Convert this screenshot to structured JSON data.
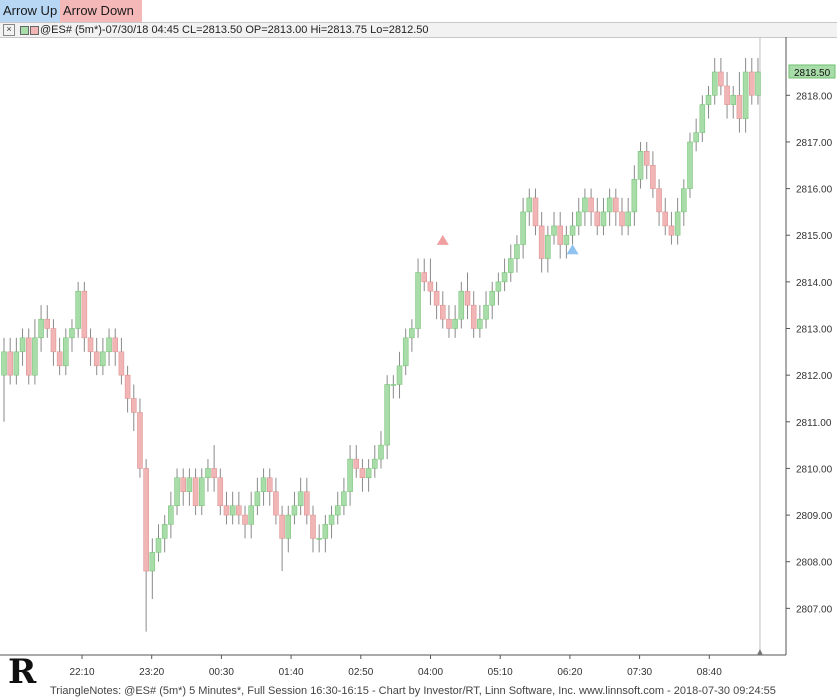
{
  "toolbar": {
    "arrow_up_label": "Arrow Up",
    "arrow_down_label": "Arrow Down",
    "arrow_up_color": "#b7d7f5",
    "arrow_down_color": "#f5b8b8"
  },
  "header": {
    "info": "@ES# (5m*)-07/30/18 04:45 CL=2813.50 OP=2813.00 Hi=2813.75 Lo=2812.50",
    "up_color": "#a8dca8",
    "down_color": "#f2b5b5"
  },
  "footer": {
    "text": "TriangleNotes: @ES# (5m*) 5 Minutes*, Full Session 16:30-16:15 - Chart by Investor/RT, Linn Software, Inc. www.linnsoft.com - 2018-07-30 09:24:55"
  },
  "chart_data": {
    "type": "candlestick",
    "last_price_label": "2818.50",
    "y_ticks": [
      "2807.00",
      "2808.00",
      "2809.00",
      "2810.00",
      "2811.00",
      "2812.00",
      "2813.00",
      "2814.00",
      "2815.00",
      "2816.00",
      "2817.00",
      "2818.00"
    ],
    "x_ticks": [
      "22:10",
      "23:20",
      "00:30",
      "01:40",
      "02:50",
      "04:00",
      "05:10",
      "06:20",
      "07:30",
      "08:40"
    ],
    "ylim": [
      2806.0,
      2819.25
    ],
    "colors": {
      "up": "#a8dca8",
      "down": "#f2b5b5",
      "up_edge": "#6fbf6f",
      "down_edge": "#d98c8c",
      "wick": "#8a8a8a",
      "arrow_up": "#8fc2ef",
      "arrow_down": "#f0a0a0"
    },
    "candles": [
      [
        2812.0,
        2812.8,
        2811.0,
        2812.5
      ],
      [
        2812.5,
        2812.8,
        2811.8,
        2812.0
      ],
      [
        2812.0,
        2812.8,
        2811.8,
        2812.5
      ],
      [
        2812.5,
        2813.0,
        2812.2,
        2812.8
      ],
      [
        2812.8,
        2813.0,
        2811.8,
        2812.0
      ],
      [
        2812.0,
        2813.2,
        2811.8,
        2812.8
      ],
      [
        2812.8,
        2813.5,
        2812.5,
        2813.2
      ],
      [
        2813.2,
        2813.5,
        2812.8,
        2813.0
      ],
      [
        2813.0,
        2813.2,
        2812.2,
        2812.5
      ],
      [
        2812.5,
        2812.8,
        2812.0,
        2812.2
      ],
      [
        2812.2,
        2813.0,
        2812.0,
        2812.8
      ],
      [
        2812.8,
        2813.2,
        2812.5,
        2813.0
      ],
      [
        2813.0,
        2814.0,
        2812.8,
        2813.8
      ],
      [
        2813.8,
        2814.0,
        2812.5,
        2812.8
      ],
      [
        2812.8,
        2813.0,
        2812.2,
        2812.5
      ],
      [
        2812.5,
        2812.8,
        2812.0,
        2812.2
      ],
      [
        2812.2,
        2812.8,
        2812.0,
        2812.5
      ],
      [
        2812.5,
        2813.0,
        2812.2,
        2812.8
      ],
      [
        2812.8,
        2813.0,
        2812.2,
        2812.5
      ],
      [
        2812.5,
        2812.8,
        2811.8,
        2812.0
      ],
      [
        2812.0,
        2812.2,
        2811.2,
        2811.5
      ],
      [
        2811.5,
        2811.8,
        2810.8,
        2811.2
      ],
      [
        2811.2,
        2811.5,
        2809.8,
        2810.0
      ],
      [
        2810.0,
        2810.2,
        2806.5,
        2807.8
      ],
      [
        2807.8,
        2808.5,
        2807.2,
        2808.2
      ],
      [
        2808.2,
        2808.8,
        2808.0,
        2808.5
      ],
      [
        2808.5,
        2809.0,
        2808.2,
        2808.8
      ],
      [
        2808.8,
        2809.5,
        2808.5,
        2809.2
      ],
      [
        2809.2,
        2810.0,
        2809.0,
        2809.8
      ],
      [
        2809.8,
        2810.0,
        2809.2,
        2809.5
      ],
      [
        2809.5,
        2810.0,
        2809.2,
        2809.8
      ],
      [
        2809.8,
        2810.0,
        2809.0,
        2809.2
      ],
      [
        2809.2,
        2810.0,
        2809.0,
        2809.8
      ],
      [
        2809.8,
        2810.2,
        2809.5,
        2810.0
      ],
      [
        2810.0,
        2810.5,
        2809.5,
        2809.8
      ],
      [
        2809.8,
        2810.0,
        2809.0,
        2809.2
      ],
      [
        2809.2,
        2809.5,
        2808.8,
        2809.0
      ],
      [
        2809.0,
        2809.5,
        2808.8,
        2809.2
      ],
      [
        2809.2,
        2809.5,
        2808.8,
        2809.0
      ],
      [
        2809.0,
        2809.2,
        2808.5,
        2808.8
      ],
      [
        2808.8,
        2809.5,
        2808.5,
        2809.2
      ],
      [
        2809.2,
        2809.8,
        2809.0,
        2809.5
      ],
      [
        2809.5,
        2810.0,
        2809.2,
        2809.8
      ],
      [
        2809.8,
        2810.0,
        2809.2,
        2809.5
      ],
      [
        2809.5,
        2809.8,
        2808.8,
        2809.0
      ],
      [
        2809.0,
        2809.2,
        2807.8,
        2808.5
      ],
      [
        2808.5,
        2809.2,
        2808.2,
        2809.0
      ],
      [
        2809.0,
        2809.5,
        2808.8,
        2809.2
      ],
      [
        2809.2,
        2809.8,
        2809.0,
        2809.5
      ],
      [
        2809.5,
        2809.8,
        2808.8,
        2809.0
      ],
      [
        2809.0,
        2809.2,
        2808.2,
        2808.5
      ],
      [
        2808.5,
        2808.8,
        2808.2,
        2808.5
      ],
      [
        2808.5,
        2809.0,
        2808.2,
        2808.8
      ],
      [
        2808.8,
        2809.2,
        2808.5,
        2809.0
      ],
      [
        2809.0,
        2809.5,
        2808.8,
        2809.2
      ],
      [
        2809.2,
        2809.8,
        2809.0,
        2809.5
      ],
      [
        2809.5,
        2810.5,
        2809.2,
        2810.2
      ],
      [
        2810.2,
        2810.5,
        2809.8,
        2810.0
      ],
      [
        2810.0,
        2810.2,
        2809.5,
        2809.8
      ],
      [
        2809.8,
        2810.2,
        2809.5,
        2810.0
      ],
      [
        2810.0,
        2810.5,
        2809.8,
        2810.2
      ],
      [
        2810.2,
        2810.8,
        2810.0,
        2810.5
      ],
      [
        2810.5,
        2812.0,
        2810.2,
        2811.8
      ],
      [
        2811.8,
        2812.0,
        2811.5,
        2811.8
      ],
      [
        2811.8,
        2812.5,
        2811.5,
        2812.2
      ],
      [
        2812.2,
        2813.0,
        2812.0,
        2812.8
      ],
      [
        2812.8,
        2813.2,
        2812.5,
        2813.0
      ],
      [
        2813.0,
        2814.5,
        2812.8,
        2814.2
      ],
      [
        2814.2,
        2814.5,
        2813.8,
        2814.0
      ],
      [
        2814.0,
        2814.5,
        2813.5,
        2813.8
      ],
      [
        2813.8,
        2814.0,
        2813.2,
        2813.5
      ],
      [
        2813.5,
        2813.8,
        2813.0,
        2813.2
      ],
      [
        2813.2,
        2813.5,
        2812.8,
        2813.0
      ],
      [
        2813.0,
        2813.5,
        2812.8,
        2813.2
      ],
      [
        2813.2,
        2814.0,
        2813.0,
        2813.8
      ],
      [
        2813.8,
        2814.2,
        2813.2,
        2813.5
      ],
      [
        2813.5,
        2813.8,
        2812.8,
        2813.0
      ],
      [
        2813.0,
        2813.5,
        2812.8,
        2813.2
      ],
      [
        2813.2,
        2813.8,
        2813.0,
        2813.5
      ],
      [
        2813.5,
        2814.0,
        2813.2,
        2813.8
      ],
      [
        2813.8,
        2814.2,
        2813.5,
        2814.0
      ],
      [
        2814.0,
        2814.5,
        2813.8,
        2814.2
      ],
      [
        2814.2,
        2814.8,
        2814.0,
        2814.5
      ],
      [
        2814.5,
        2815.0,
        2814.2,
        2814.8
      ],
      [
        2814.8,
        2815.8,
        2814.5,
        2815.5
      ],
      [
        2815.5,
        2816.0,
        2815.2,
        2815.8
      ],
      [
        2815.8,
        2816.0,
        2815.0,
        2815.2
      ],
      [
        2815.2,
        2815.5,
        2814.2,
        2814.5
      ],
      [
        2814.5,
        2815.2,
        2814.2,
        2815.0
      ],
      [
        2815.0,
        2815.5,
        2814.8,
        2815.2
      ],
      [
        2815.2,
        2815.5,
        2814.5,
        2814.8
      ],
      [
        2814.8,
        2815.2,
        2814.5,
        2815.0
      ],
      [
        2815.0,
        2815.5,
        2814.8,
        2815.2
      ],
      [
        2815.2,
        2815.8,
        2815.0,
        2815.5
      ],
      [
        2815.5,
        2816.0,
        2815.2,
        2815.8
      ],
      [
        2815.8,
        2816.0,
        2815.2,
        2815.5
      ],
      [
        2815.5,
        2815.8,
        2815.0,
        2815.2
      ],
      [
        2815.2,
        2815.8,
        2815.0,
        2815.5
      ],
      [
        2815.5,
        2816.0,
        2815.2,
        2815.8
      ],
      [
        2815.8,
        2816.0,
        2815.2,
        2815.5
      ],
      [
        2815.5,
        2815.8,
        2815.0,
        2815.2
      ],
      [
        2815.2,
        2815.8,
        2815.0,
        2815.5
      ],
      [
        2815.5,
        2816.5,
        2815.2,
        2816.2
      ],
      [
        2816.2,
        2817.0,
        2816.0,
        2816.8
      ],
      [
        2816.8,
        2817.0,
        2816.2,
        2816.5
      ],
      [
        2816.5,
        2816.8,
        2815.8,
        2816.0
      ],
      [
        2816.0,
        2816.2,
        2815.2,
        2815.5
      ],
      [
        2815.5,
        2815.8,
        2815.0,
        2815.2
      ],
      [
        2815.2,
        2815.5,
        2814.8,
        2815.0
      ],
      [
        2815.0,
        2815.8,
        2814.8,
        2815.5
      ],
      [
        2815.5,
        2816.2,
        2815.2,
        2816.0
      ],
      [
        2816.0,
        2817.2,
        2815.8,
        2817.0
      ],
      [
        2817.0,
        2817.5,
        2816.8,
        2817.2
      ],
      [
        2817.2,
        2818.0,
        2817.0,
        2817.8
      ],
      [
        2817.8,
        2818.2,
        2817.5,
        2818.0
      ],
      [
        2818.0,
        2818.8,
        2817.8,
        2818.5
      ],
      [
        2818.5,
        2818.8,
        2818.0,
        2818.2
      ],
      [
        2818.2,
        2818.5,
        2817.5,
        2817.8
      ],
      [
        2817.8,
        2818.2,
        2817.5,
        2818.0
      ],
      [
        2818.0,
        2818.5,
        2817.2,
        2817.5
      ],
      [
        2817.5,
        2818.8,
        2817.2,
        2818.5
      ],
      [
        2818.5,
        2818.8,
        2817.8,
        2818.0
      ],
      [
        2818.0,
        2818.8,
        2817.8,
        2818.5
      ]
    ],
    "arrows": [
      {
        "type": "down",
        "price": 2814.9,
        "candle": 71
      },
      {
        "type": "up",
        "price": 2814.7,
        "candle": 92
      }
    ]
  }
}
